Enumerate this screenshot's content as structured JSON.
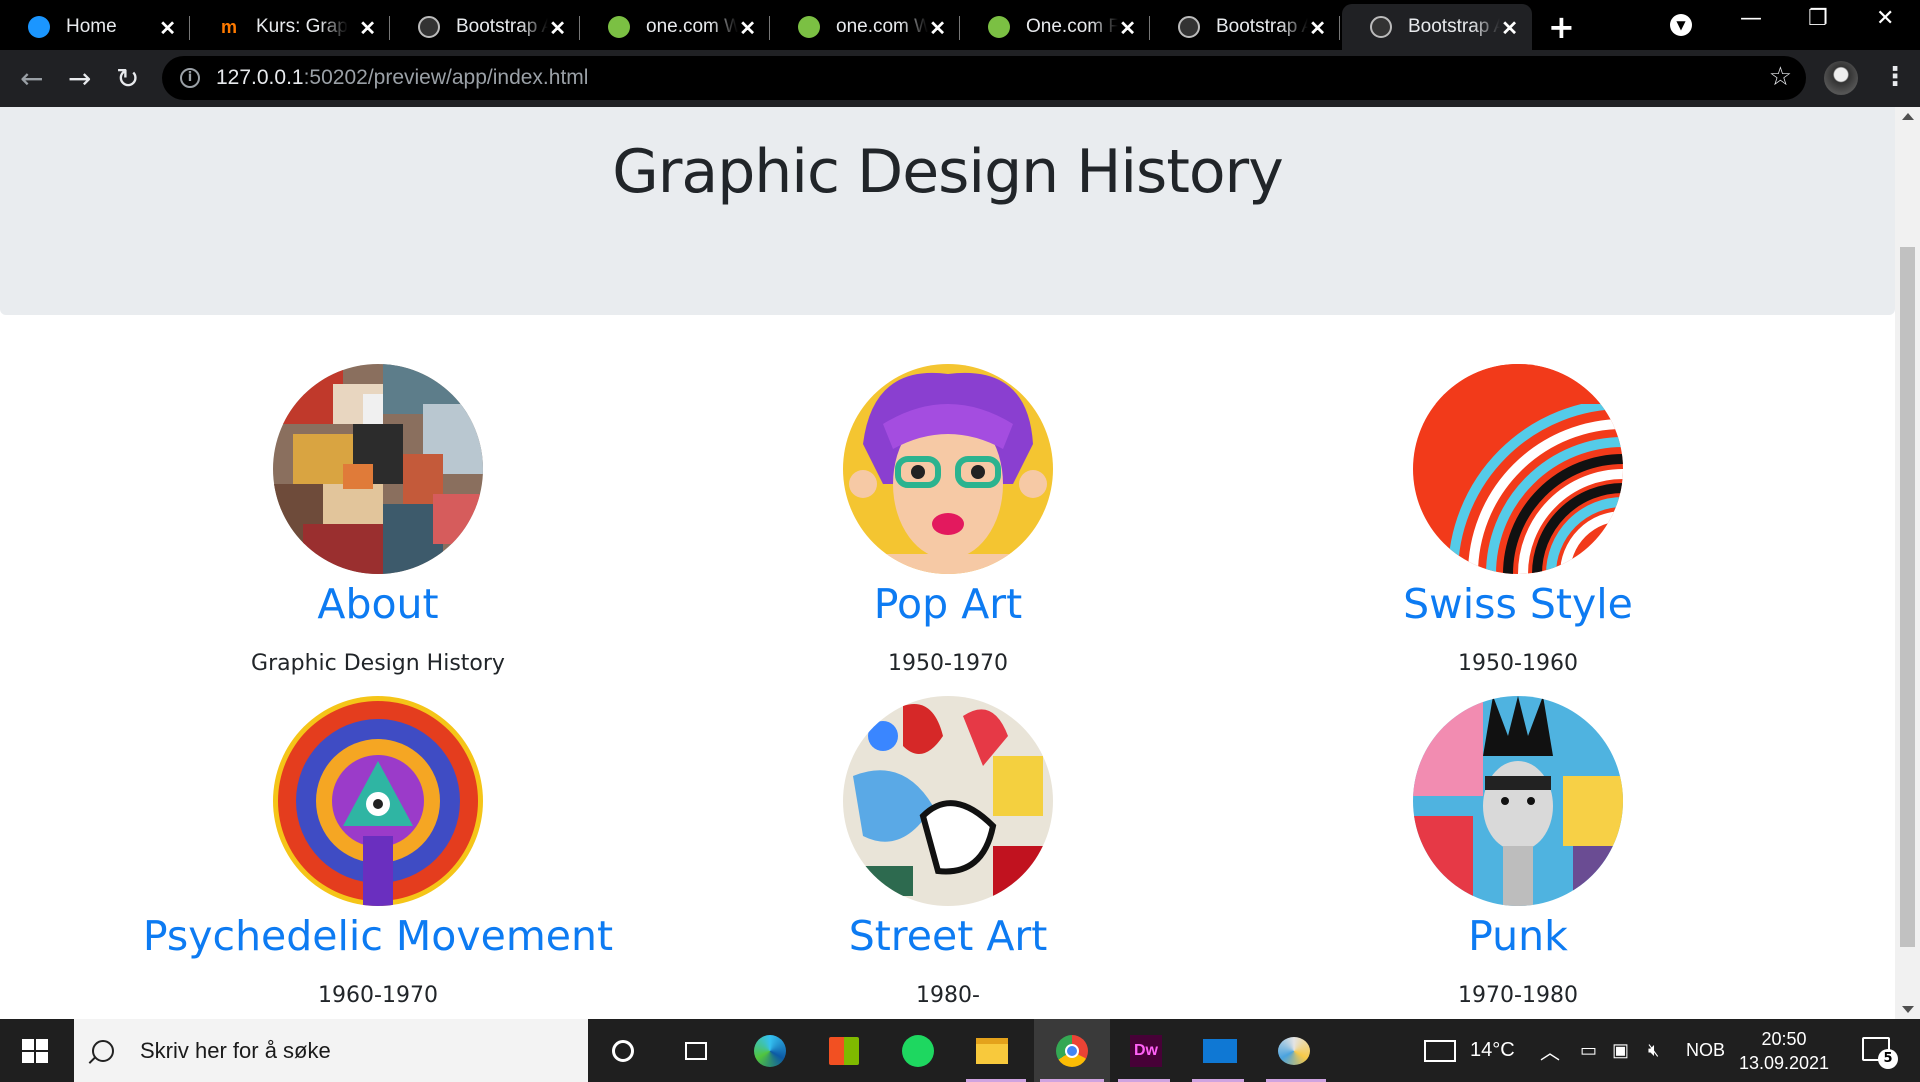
{
  "browser": {
    "tabs": [
      {
        "title": "Home",
        "favicon": "salesforce-cloud-icon"
      },
      {
        "title": "Kurs: Graphic",
        "favicon": "m-logo-icon"
      },
      {
        "title": "Bootstrap A",
        "favicon": "globe-icon"
      },
      {
        "title": "one.com We",
        "favicon": "green-dot-icon"
      },
      {
        "title": "one.com We",
        "favicon": "green-dot-icon"
      },
      {
        "title": "One.com Fil",
        "favicon": "green-dot-icon"
      },
      {
        "title": "Bootstrap A",
        "favicon": "globe-icon"
      },
      {
        "title": "Bootstrap A",
        "favicon": "globe-icon",
        "active": true
      }
    ],
    "url_host": "127.0.0.1",
    "url_rest": ":50202/preview/app/index.html"
  },
  "page": {
    "title": "Graphic Design History",
    "cards": [
      {
        "name": "About",
        "subtitle": "Graphic Design History",
        "image": "abstract-collage"
      },
      {
        "name": "Pop Art",
        "subtitle": "1950-1970",
        "image": "pop-art-woman-glasses"
      },
      {
        "name": "Swiss Style",
        "subtitle": "1950-1960",
        "image": "swiss-stripes"
      },
      {
        "name": "Psychedelic Movement",
        "subtitle": "1960-1970",
        "image": "psychedelic-mandala"
      },
      {
        "name": "Street Art",
        "subtitle": "1980-",
        "image": "graffiti"
      },
      {
        "name": "Punk",
        "subtitle": "1970-1980",
        "image": "punk-portrait"
      }
    ],
    "link_color": "#0d7bf2",
    "jumbotron_color": "#e9ecef"
  },
  "taskbar": {
    "search_placeholder": "Skriv her for å søke",
    "weather": "14°C",
    "language": "NOB",
    "time": "20:50",
    "date": "13.09.2021",
    "notification_count": "5",
    "apps": [
      "cortana-icon",
      "task-view-icon",
      "edge-icon",
      "store-icon",
      "spotify-icon",
      "file-explorer-icon",
      "chrome-icon",
      "dreamweaver-icon",
      "mail-icon",
      "paint-icon"
    ]
  }
}
